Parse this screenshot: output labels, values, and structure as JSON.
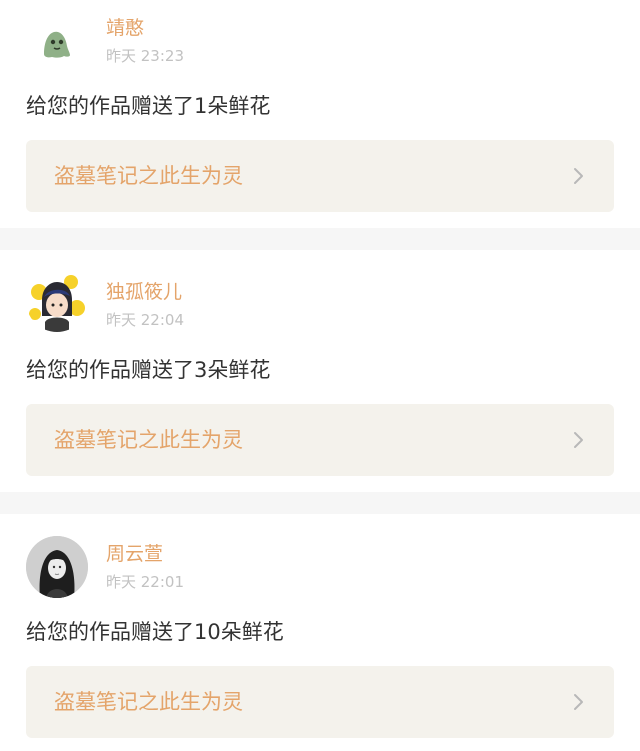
{
  "notifications": [
    {
      "user": "靖憨",
      "time": "昨天 23:23",
      "message": "给您的作品赠送了1朵鲜花",
      "work_title": "盗墓笔记之此生为灵",
      "avatar_icon": "green-blob-avatar-icon"
    },
    {
      "user": "独孤筱儿",
      "time": "昨天 22:04",
      "message": "给您的作品赠送了3朵鲜花",
      "work_title": "盗墓笔记之此生为灵",
      "avatar_icon": "cartoon-girl-avatar-icon"
    },
    {
      "user": "周云萱",
      "time": "昨天 22:01",
      "message": "给您的作品赠送了10朵鲜花",
      "work_title": "盗墓笔记之此生为灵",
      "avatar_icon": "photo-girl-avatar-icon"
    }
  ],
  "colors": {
    "name": "#e4a46a",
    "time": "#c2c2c2",
    "message": "#333333",
    "work_bg": "#f4f2ec",
    "separator": "#f6f6f6"
  }
}
